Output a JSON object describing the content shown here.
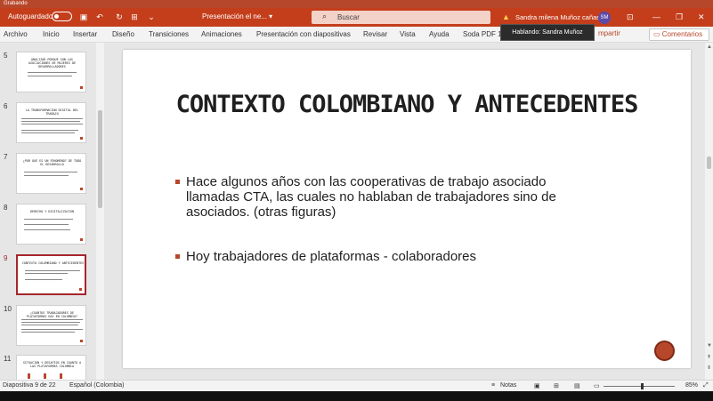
{
  "recording": {
    "label": "Grabando"
  },
  "titlebar": {
    "autosave_label": "Autoguardado",
    "autosave_state": "off",
    "document_title": "Presentación el ne...  ▾",
    "search_placeholder": "Buscar",
    "user_name": "Sandra milena Muñoz cañas",
    "avatar_initials": "SM"
  },
  "tooltip": {
    "speaking": "Hablando: Sandra Muñoz"
  },
  "menu": {
    "items": [
      "Archivo",
      "Inicio",
      "Insertar",
      "Diseño",
      "Transiciones",
      "Animaciones",
      "Presentación con diapositivas",
      "Revisar",
      "Vista",
      "Ayuda",
      "Soda PDF 1"
    ],
    "share_label": "mpartir",
    "comments_label": "Comentarios"
  },
  "thumbnails": [
    {
      "number": "5",
      "title": "ANALIZAR PORQUE SON LAS ASOCIACIONES DE MUJERES DE DESARROLLADORES"
    },
    {
      "number": "6",
      "title": "LA TRANSFORMACIÓN DIGITAL DEL TRABAJO"
    },
    {
      "number": "7",
      "title": "¿POR QUÉ ES UN FENÓMENO? DE TODO EL DESARROLLO"
    },
    {
      "number": "8",
      "title": "DERECHO Y DIGITALIZACIÓN"
    },
    {
      "number": "9",
      "title": "CONTEXTO COLOMBIANO Y ANTECEDENTES",
      "active": true
    },
    {
      "number": "10",
      "title": "¿CUÁNTOS TRABAJADORES DE PLATAFORMAS HAY EN COLOMBIA?"
    },
    {
      "number": "11",
      "title": "SITUACIÓN Y DESAFÍOS EN CUANTO A LAS PLATAFORMAS COLOMBIA"
    }
  ],
  "slide": {
    "title": "CONTEXTO COLOMBIANO Y ANTECEDENTES",
    "bullets": [
      "Hace algunos años con las cooperativas de trabajo asociado llamadas CTA, las cuales no hablaban de trabajadores sino de asociados. (otras figuras)",
      "Hoy trabajadores de plataformas - colaboradores"
    ]
  },
  "status": {
    "slide_counter": "Diapositiva 9 de 22",
    "language": "Español (Colombia)",
    "notes_label": "Notas",
    "zoom": "85%"
  },
  "colors": {
    "accent": "#c43e1c",
    "bullet": "#b7472a",
    "active_thumb": "#a4262c"
  }
}
